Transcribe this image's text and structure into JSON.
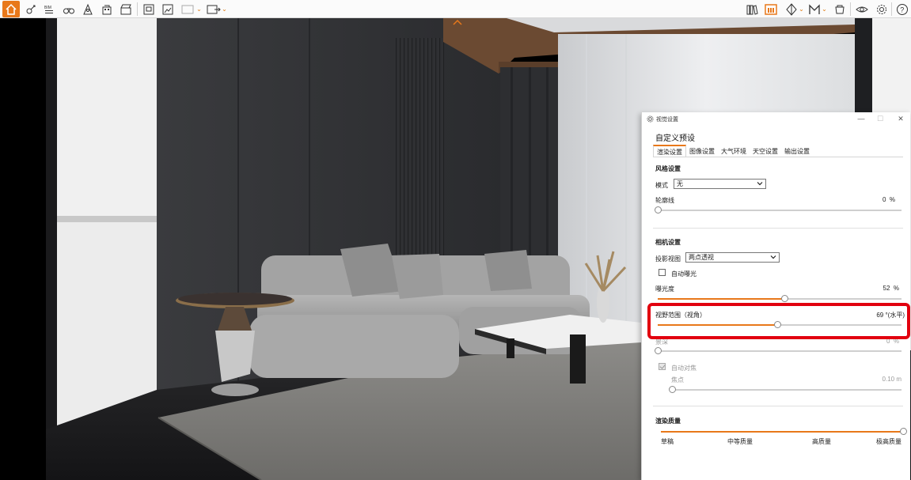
{
  "toolbar": {
    "left_icons": [
      "home-icon",
      "pin-tool-icon",
      "bim-icon",
      "binoculars-icon",
      "tower-icon",
      "building-icon",
      "clapper-icon",
      "render-doc-icon",
      "render-image-icon",
      "frame-dropdown-icon",
      "export-dropdown-icon"
    ],
    "right_icons": [
      "library-icon",
      "render-panel-icon",
      "section-icon",
      "mirror-icon",
      "material-icon",
      "visibility-icon",
      "settings-icon",
      "help-icon"
    ],
    "accent": "#e8781a"
  },
  "scene": {
    "collapse_icon": "chevron-up-icon"
  },
  "panel": {
    "title": "视觉设置",
    "title_icon": "gear-icon",
    "preset": "自定义预设",
    "tabs": [
      "渲染设置",
      "图像设置",
      "大气环境",
      "天空设置",
      "输出设置"
    ],
    "active_tab": 0,
    "style_section": {
      "heading": "风格设置",
      "mode_label": "模式",
      "mode_value": "无",
      "outline_label": "轮廓线",
      "outline_value": "0",
      "outline_unit": "%",
      "outline_fraction": 0.0
    },
    "camera_section": {
      "heading": "相机设置",
      "projection_label": "投影视图",
      "projection_value": "两点透视",
      "auto_exposure_label": "自动曝光",
      "auto_exposure_checked": false,
      "exposure_label": "曝光度",
      "exposure_value": "52",
      "exposure_unit": "%",
      "exposure_fraction": 0.52,
      "fov_label": "视野范围（视角）",
      "fov_value": "69",
      "fov_unit": "°(水平)",
      "fov_fraction": 0.49,
      "dof_label": "景深",
      "dof_value": "0",
      "dof_unit": "%",
      "dof_fraction": 0.0,
      "autofocus_label": "自动对焦",
      "autofocus_checked": true,
      "focus_label": "焦点",
      "focus_value": "0.10",
      "focus_unit": "m",
      "focus_fraction": 0.0
    },
    "quality_section": {
      "heading": "渲染质量",
      "levels": [
        "草稿",
        "中等质量",
        "高质量",
        "极高质量"
      ],
      "quality_fraction": 1.0
    },
    "highlight_color": "#e2000f"
  }
}
